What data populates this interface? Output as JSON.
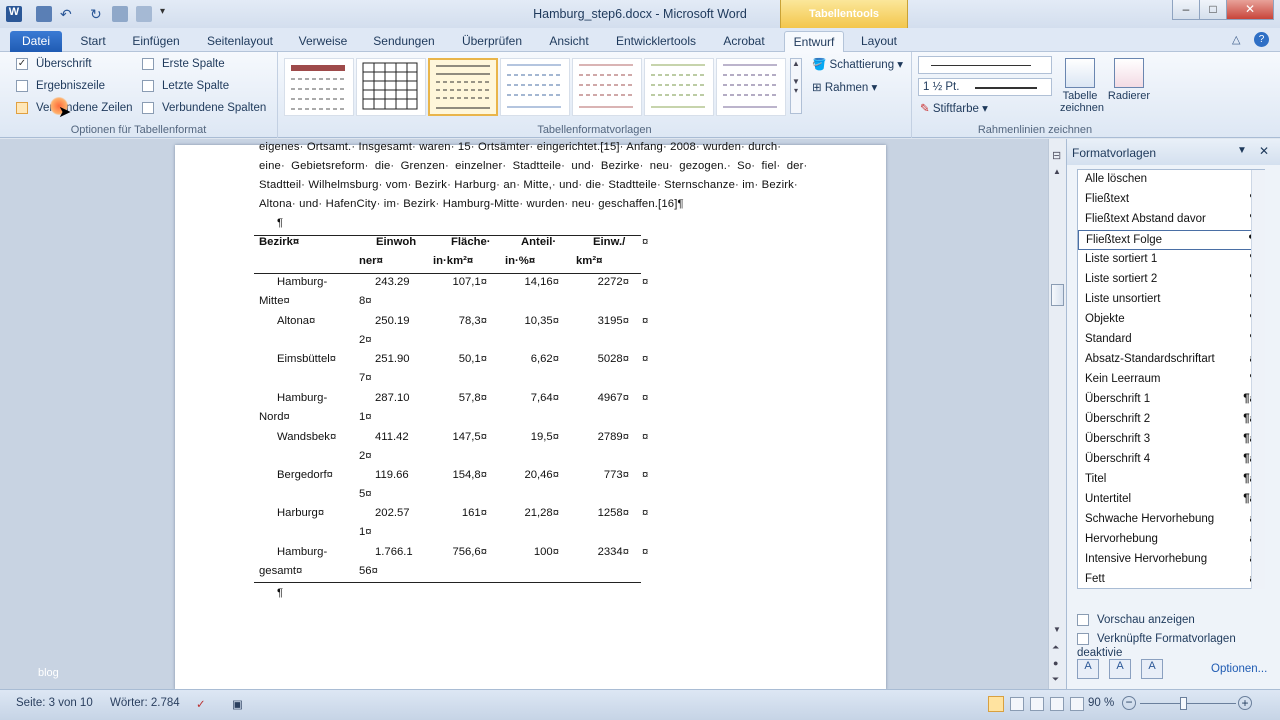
{
  "window": {
    "title": "Hamburg_step6.docx - Microsoft Word",
    "context_tab": "Tabellentools",
    "min": "–",
    "max": "□",
    "close": "✕"
  },
  "tabs": [
    "Datei",
    "Start",
    "Einfügen",
    "Seitenlayout",
    "Verweise",
    "Sendungen",
    "Überprüfen",
    "Ansicht",
    "Entwicklertools",
    "Acrobat",
    "Entwurf",
    "Layout"
  ],
  "ribbon": {
    "options": {
      "header_row": "Überschrift",
      "first_col": "Erste Spalte",
      "total_row": "Ergebniszeile",
      "last_col": "Letzte Spalte",
      "banded_rows": "Verbundene Zeilen",
      "banded_cols": "Verbundene Spalten",
      "group_label": "Optionen für Tabellenformat"
    },
    "styles_label": "Tabellenformatvorlagen",
    "shading": "Schattierung",
    "borders": "Rahmen",
    "pen_weight": "1 ½ Pt.",
    "pen_color": "Stiftfarbe",
    "draw_table": "Tabelle zeichnen",
    "eraser": "Radierer",
    "borders_group": "Rahmenlinien zeichnen"
  },
  "document": {
    "lines": [
      "eigenes· Ortsamt.· Insgesamt· waren· 15· Ortsämter· eingerichtet.[15]· Anfang· 2008· wurden· durch·",
      "eine· Gebietsreform· die· Grenzen· einzelner· Stadtteile· und· Bezirke· neu· gezogen.· So· fiel· der·",
      "Stadtteil· Wilhelmsburg· vom· Bezirk· Harburg· an· Mitte,· und· die· Stadtteile· Sternschanze· im· Bezirk·",
      "Altona· und· HafenCity· im· Bezirk· Hamburg-Mitte· wurden· neu· geschaffen.[16]¶"
    ],
    "para_mark": "¶",
    "table": {
      "headers": [
        [
          "Bezirk¤",
          ""
        ],
        [
          "Einwoh",
          "ner¤"
        ],
        [
          "Fläche·",
          "in·km²¤"
        ],
        [
          "Anteil·",
          "in·%¤"
        ],
        [
          "Einw./",
          "km²¤"
        ]
      ],
      "rows": [
        [
          [
            "Hamburg-",
            "Mitte¤"
          ],
          [
            "243.29",
            "8¤"
          ],
          "107,1¤",
          "14,16¤",
          "2272¤"
        ],
        [
          [
            "Altona¤",
            ""
          ],
          [
            "250.19",
            "2¤"
          ],
          "78,3¤",
          "10,35¤",
          "3195¤"
        ],
        [
          [
            "Eimsbüttel¤",
            ""
          ],
          [
            "251.90",
            "7¤"
          ],
          "50,1¤",
          "6,62¤",
          "5028¤"
        ],
        [
          [
            "Hamburg-",
            "Nord¤"
          ],
          [
            "287.10",
            "1¤"
          ],
          "57,8¤",
          "7,64¤",
          "4967¤"
        ],
        [
          [
            "Wandsbek¤",
            ""
          ],
          [
            "411.42",
            "2¤"
          ],
          "147,5¤",
          "19,5¤",
          "2789¤"
        ],
        [
          [
            "Bergedorf¤",
            ""
          ],
          [
            "119.66",
            "5¤"
          ],
          "154,8¤",
          "20,46¤",
          "773¤"
        ],
        [
          [
            "Harburg¤",
            ""
          ],
          [
            "202.57",
            "1¤"
          ],
          "161¤",
          "21,28¤",
          "1258¤"
        ],
        [
          [
            "Hamburg-",
            "gesamt¤"
          ],
          [
            "1.766.1",
            "56¤"
          ],
          "756,6¤",
          "100¤",
          "2334¤"
        ]
      ],
      "end_mark": "¤"
    },
    "watermark": "blog"
  },
  "styles_pane": {
    "title": "Formatvorlagen",
    "items": [
      {
        "name": "Alle löschen",
        "mark": ""
      },
      {
        "name": "Fließtext",
        "mark": "¶"
      },
      {
        "name": "Fließtext Abstand davor",
        "mark": "¶"
      },
      {
        "name": "Fließtext Folge",
        "mark": "¶"
      },
      {
        "name": "Liste sortiert 1",
        "mark": "¶"
      },
      {
        "name": "Liste sortiert 2",
        "mark": "¶"
      },
      {
        "name": "Liste unsortiert",
        "mark": "¶"
      },
      {
        "name": "Objekte",
        "mark": "¶"
      },
      {
        "name": "Standard",
        "mark": "¶"
      },
      {
        "name": "Absatz-Standardschriftart",
        "mark": "a"
      },
      {
        "name": "Kein Leerraum",
        "mark": "¶"
      },
      {
        "name": "Überschrift 1",
        "mark": "¶a"
      },
      {
        "name": "Überschrift 2",
        "mark": "¶a"
      },
      {
        "name": "Überschrift 3",
        "mark": "¶a"
      },
      {
        "name": "Überschrift 4",
        "mark": "¶a"
      },
      {
        "name": "Titel",
        "mark": "¶a"
      },
      {
        "name": "Untertitel",
        "mark": "¶a"
      },
      {
        "name": "Schwache Hervorhebung",
        "mark": "a"
      },
      {
        "name": "Hervorhebung",
        "mark": "a"
      },
      {
        "name": "Intensive Hervorhebung",
        "mark": "a"
      },
      {
        "name": "Fett",
        "mark": "a"
      }
    ],
    "selected_index": 3,
    "preview": "Vorschau anzeigen",
    "linked": "Verknüpfte Formatvorlagen deaktivie",
    "options": "Optionen..."
  },
  "status": {
    "page": "Seite: 3 von 10",
    "words": "Wörter: 2.784",
    "zoom": "90 %"
  }
}
